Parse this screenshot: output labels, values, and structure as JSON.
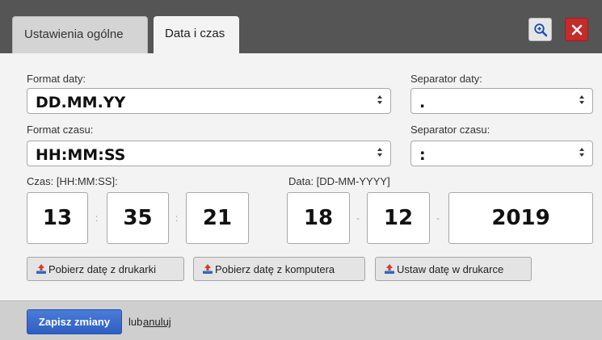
{
  "tabs": [
    {
      "label": "Ustawienia ogólne",
      "active": false
    },
    {
      "label": "Data i czas",
      "active": true
    }
  ],
  "header_buttons": {
    "zoom_icon": "zoom-in-icon",
    "close_icon": "close-icon"
  },
  "form": {
    "date_format": {
      "label": "Format daty:",
      "value": "DD.MM.YY"
    },
    "date_separator": {
      "label": "Separator daty:",
      "value": "."
    },
    "time_format": {
      "label": "Format czasu:",
      "value": "HH:MM:SS"
    },
    "time_separator": {
      "label": "Separator czasu:",
      "value": ":"
    }
  },
  "time": {
    "label": "Czas: [HH:MM:SS]:",
    "hours": "13",
    "minutes": "35",
    "seconds": "21",
    "separator": ":"
  },
  "date": {
    "label": "Data: [DD-MM-YYYY]",
    "day": "18",
    "month": "12",
    "year": "2019",
    "separator": "-"
  },
  "actions": {
    "get_printer_date": "Pobierz datę z drukarki",
    "get_computer_date": "Pobierz datę z komputera",
    "set_printer_date": "Ustaw datę w drukarce"
  },
  "footer": {
    "save_label": "Zapisz zmiany",
    "or_text": "lub",
    "cancel_label": "anuluj"
  },
  "colors": {
    "save": "#2e5fc2",
    "close": "#c52b2b"
  }
}
